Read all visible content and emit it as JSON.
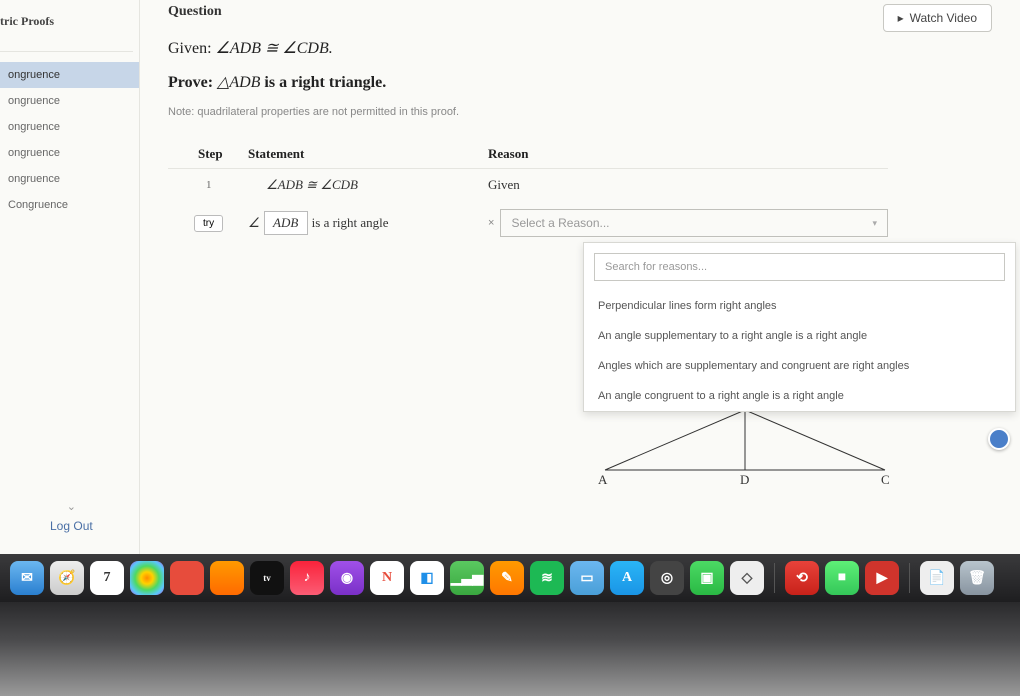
{
  "sidebar": {
    "title": "tric Proofs",
    "items": [
      {
        "label": "ongruence"
      },
      {
        "label": "ongruence"
      },
      {
        "label": "ongruence"
      },
      {
        "label": "ongruence"
      },
      {
        "label": "ongruence"
      },
      {
        "label": "Congruence"
      }
    ],
    "logout": "Log Out",
    "chevron": "⌄"
  },
  "header": {
    "question_label": "Question",
    "watch_video": "Watch Video"
  },
  "problem": {
    "given_prefix": "Given: ",
    "given_math": "∠ADB ≅ ∠CDB.",
    "prove_prefix": "Prove: ",
    "prove_math": "△ADB",
    "prove_suffix": " is a right triangle.",
    "note": "Note: quadrilateral properties are not permitted in this proof."
  },
  "table": {
    "headers": {
      "step": "Step",
      "statement": "Statement",
      "reason": "Reason"
    },
    "rows": [
      {
        "step": "1",
        "statement": "∠ADB ≅ ∠CDB",
        "reason": "Given"
      },
      {
        "try": "try",
        "angle": "∠",
        "input": "ADB",
        "suffix": "is a right angle",
        "reason_placeholder": "Select a Reason..."
      }
    ]
  },
  "dropdown": {
    "search_placeholder": "Search for reasons...",
    "options": [
      "Perpendicular lines form right angles",
      "An angle supplementary to a right angle is a right angle",
      "Angles which are supplementary and congruent are right angles",
      "An angle congruent to a right angle is a right angle"
    ]
  },
  "figure": {
    "labels": {
      "A": "A",
      "D": "D",
      "C": "C"
    }
  },
  "dock": {
    "icons": [
      {
        "name": "mail",
        "bg": "linear-gradient(#6bb7f0,#2a7fd0)",
        "glyph": "✉"
      },
      {
        "name": "safari",
        "bg": "linear-gradient(#eee,#ccc)",
        "glyph": "🧭"
      },
      {
        "name": "calendar",
        "bg": "#fff",
        "glyph": "7",
        "color": "#333"
      },
      {
        "name": "photos",
        "bg": "radial-gradient(circle,#ff8a00,#ffd200,#4cd964,#5ac8fa,#af52de)",
        "glyph": ""
      },
      {
        "name": "app1",
        "bg": "#e74c3c",
        "glyph": ""
      },
      {
        "name": "app2",
        "bg": "linear-gradient(#ff9a00,#ff6a00)",
        "glyph": ""
      },
      {
        "name": "appletv",
        "bg": "#111",
        "glyph": "tv",
        "fontsize": "9px"
      },
      {
        "name": "music",
        "bg": "linear-gradient(#fa233b,#fb5c74)",
        "glyph": "♪"
      },
      {
        "name": "podcasts",
        "bg": "linear-gradient(#a050e8,#7a30c8)",
        "glyph": "◉"
      },
      {
        "name": "news",
        "bg": "#fff",
        "glyph": "N",
        "color": "#e74c3c"
      },
      {
        "name": "app3",
        "bg": "#fff",
        "glyph": "◧",
        "color": "#1f8fe8"
      },
      {
        "name": "numbers",
        "bg": "linear-gradient(#5ac860,#3aa840)",
        "glyph": "▁▃▅"
      },
      {
        "name": "pages",
        "bg": "linear-gradient(#ff9a00,#ff7700)",
        "glyph": "✎"
      },
      {
        "name": "spotify",
        "bg": "#1db954",
        "glyph": "≋"
      },
      {
        "name": "app4",
        "bg": "linear-gradient(#6bb7f0,#4a9fd8)",
        "glyph": "▭"
      },
      {
        "name": "appstore",
        "bg": "linear-gradient(#2ab5f6,#1a95e6)",
        "glyph": "A"
      },
      {
        "name": "app5",
        "bg": "#444",
        "glyph": "◎"
      },
      {
        "name": "app6",
        "bg": "linear-gradient(#4cd964,#2ab944)",
        "glyph": "▣"
      },
      {
        "name": "roblox",
        "bg": "#eee",
        "glyph": "◇",
        "color": "#555"
      },
      {
        "name": "adobe",
        "bg": "linear-gradient(#e8423a,#c8221a)",
        "glyph": "⟲"
      },
      {
        "name": "facetime",
        "bg": "linear-gradient(#5ef077,#34c759)",
        "glyph": "■"
      },
      {
        "name": "app7",
        "bg": "#d0342c",
        "glyph": "▶"
      },
      {
        "name": "doc",
        "bg": "#eee",
        "glyph": "📄"
      },
      {
        "name": "trash",
        "bg": "linear-gradient(#b8c4cc,#8894a0)",
        "glyph": "🗑"
      }
    ]
  }
}
